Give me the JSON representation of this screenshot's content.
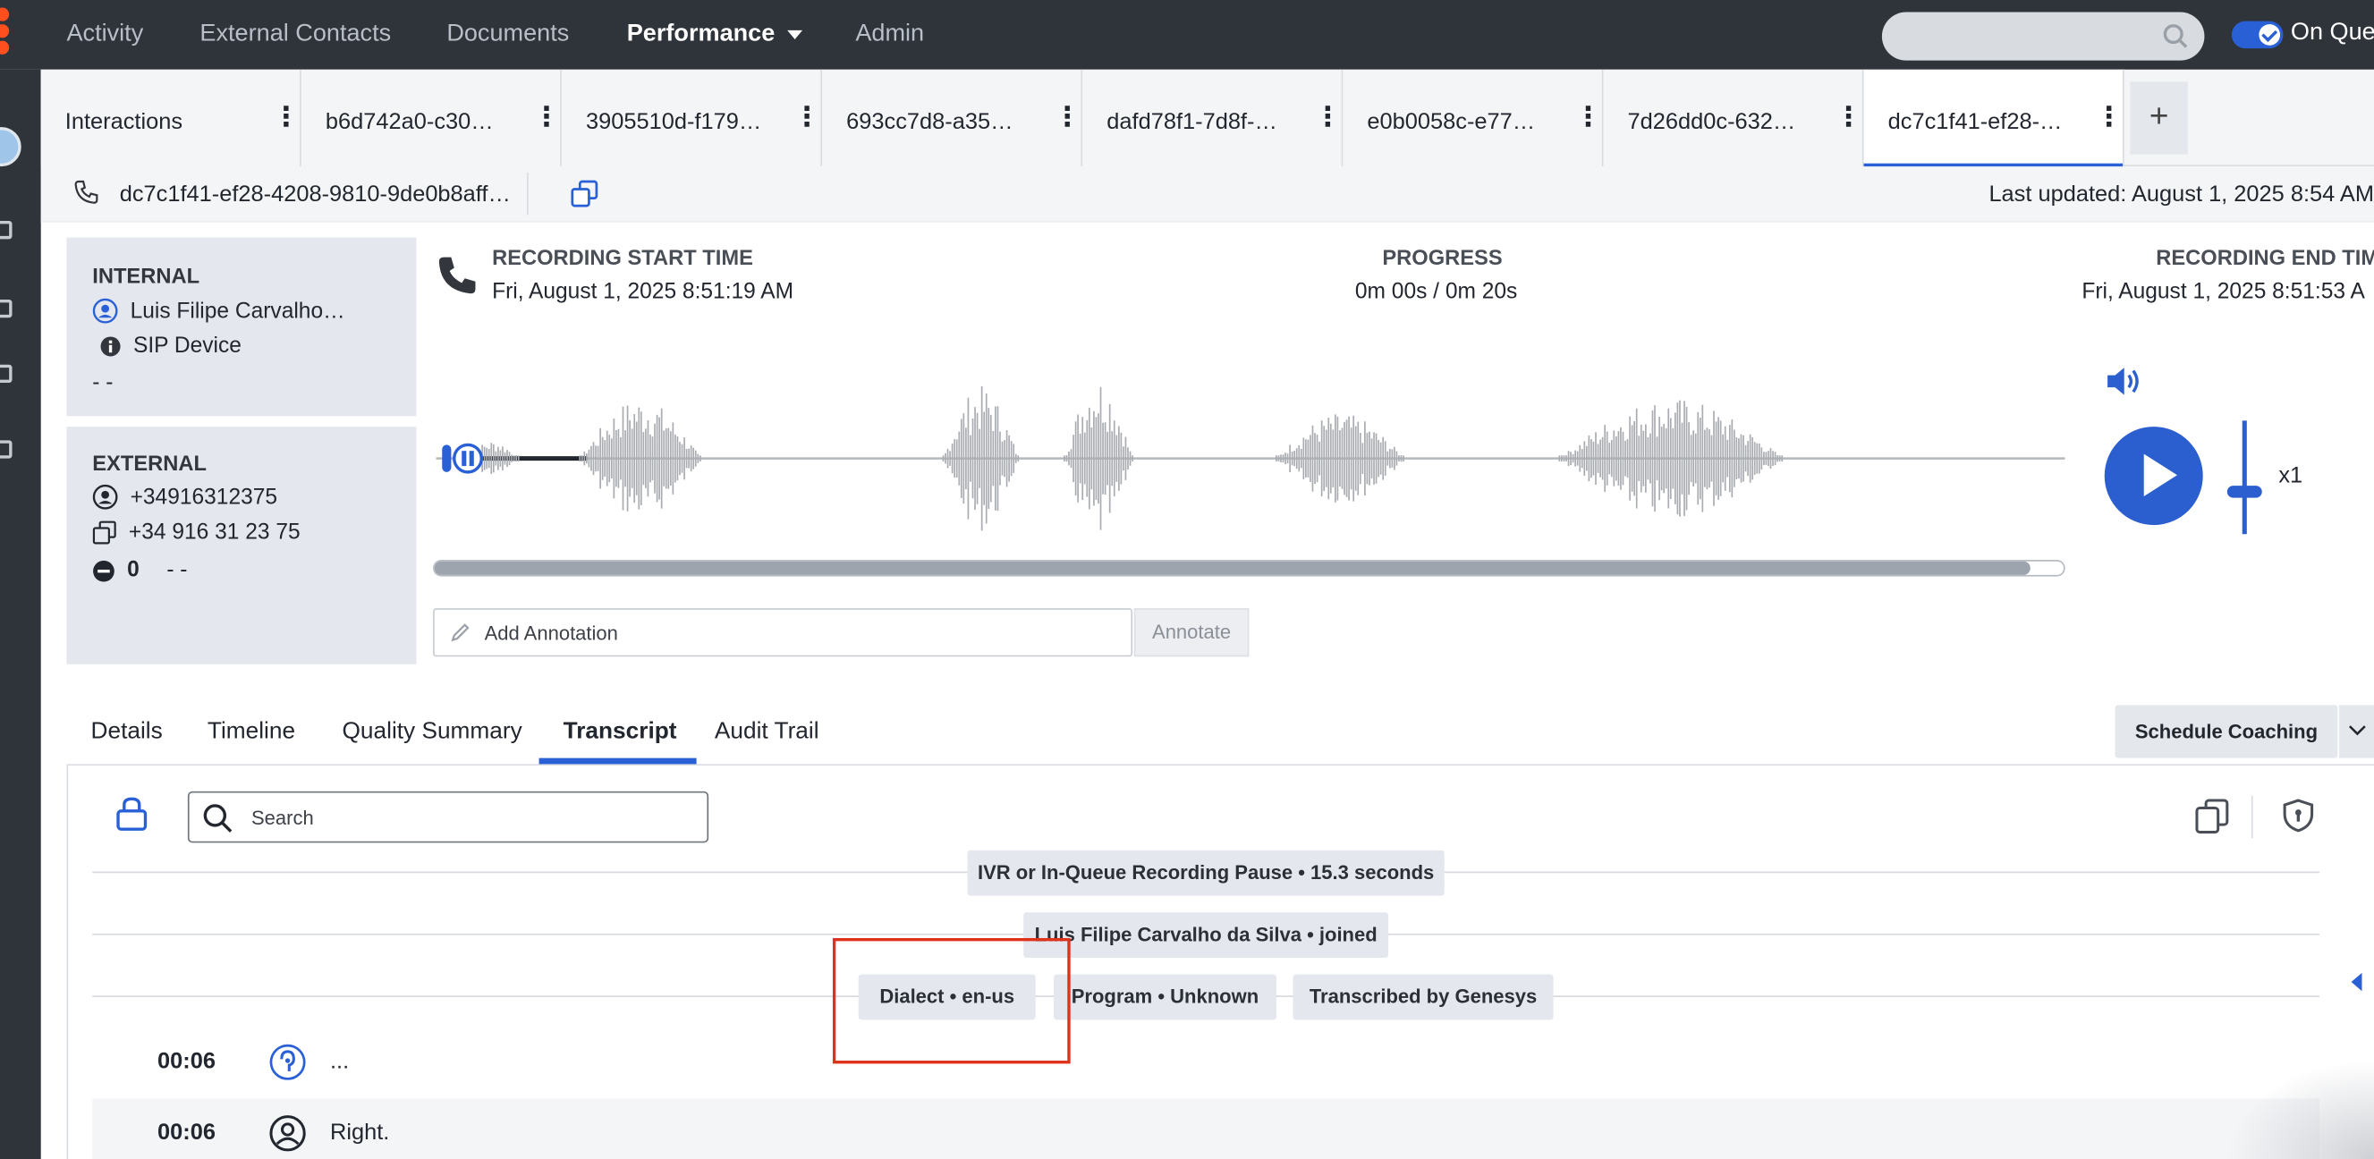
{
  "nav": {
    "items": [
      "Activity",
      "External Contacts",
      "Documents",
      "Performance",
      "Admin"
    ],
    "active": "Performance",
    "status_label": "On Que"
  },
  "tabs": [
    {
      "label": "Interactions"
    },
    {
      "label": "b6d742a0-c30…"
    },
    {
      "label": "3905510d-f179…"
    },
    {
      "label": "693cc7d8-a35…"
    },
    {
      "label": "dafd78f1-7d8f-…"
    },
    {
      "label": "e0b0058c-e77…"
    },
    {
      "label": "7d26dd0c-632…"
    },
    {
      "label": "dc7c1f41-ef28-…"
    }
  ],
  "add_tab": "+",
  "infobar": {
    "conversation_id": "dc7c1f41-ef28-4208-9810-9de0b8aff…",
    "last_updated": "Last updated: August 1, 2025 8:54 AM"
  },
  "internal": {
    "header": "INTERNAL",
    "agent": "Luis Filipe Carvalho…",
    "device": "SIP Device",
    "extra": "- -"
  },
  "external": {
    "header": "EXTERNAL",
    "number": "+34916312375",
    "formatted": "+34 916 31 23 75",
    "count": "0",
    "count_extra": "- -"
  },
  "recording": {
    "start_label": "RECORDING START TIME",
    "start_value": "Fri, August 1, 2025 8:51:19 AM",
    "progress_label": "PROGRESS",
    "progress_value": "0m 00s / 0m 20s",
    "end_label": "RECORDING END TIM",
    "end_value": "Fri, August 1, 2025 8:51:53 A",
    "playback_fraction": 0.98,
    "speed": "x1"
  },
  "annotation": {
    "placeholder": "Add Annotation",
    "button": "Annotate"
  },
  "detail_tabs": [
    "Details",
    "Timeline",
    "Quality Summary",
    "Transcript",
    "Audit Trail"
  ],
  "active_detail_tab": "Transcript",
  "schedule_coaching": "Schedule Coaching",
  "transcript": {
    "search_placeholder": "Search",
    "events": [
      "IVR or In-Queue Recording Pause • 15.3 seconds",
      "Luis Filipe Carvalho da Silva • joined"
    ],
    "meta": [
      "Dialect • en-us",
      "Program • Unknown",
      "Transcribed by Genesys"
    ],
    "lines": [
      {
        "time": "00:06",
        "speaker_icon": "ivr-icon",
        "text": "..."
      },
      {
        "time": "00:06",
        "speaker_icon": "customer-icon",
        "text": "Right."
      }
    ]
  },
  "colors": {
    "accent": "#2a60d6",
    "topbar": "#2f343a",
    "highlight": "#e0311b"
  }
}
